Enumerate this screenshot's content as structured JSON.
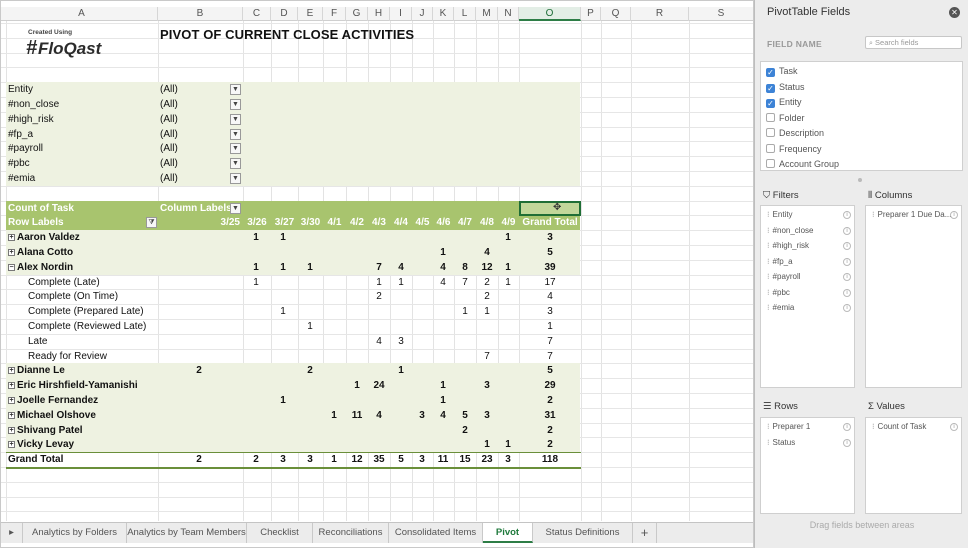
{
  "columns": [
    "A",
    "B",
    "C",
    "D",
    "E",
    "F",
    "G",
    "H",
    "I",
    "J",
    "K",
    "L",
    "M",
    "N",
    "O",
    "P",
    "Q",
    "R",
    "S"
  ],
  "selected_column": "O",
  "logo": {
    "tag": "Created Using",
    "brand": "FloQast"
  },
  "title": "PIVOT OF CURRENT CLOSE ACTIVITIES",
  "filters": [
    {
      "label": "Entity",
      "value": "(All)"
    },
    {
      "label": "#non_close",
      "value": "(All)"
    },
    {
      "label": "#high_risk",
      "value": "(All)"
    },
    {
      "label": "#fp_a",
      "value": "(All)"
    },
    {
      "label": "#payroll",
      "value": "(All)"
    },
    {
      "label": "#pbc",
      "value": "(All)"
    },
    {
      "label": "#emia",
      "value": "(All)"
    }
  ],
  "pivot": {
    "corner": "Count of Task",
    "column_labels": "Column Labels",
    "row_labels": "Row Labels",
    "dates": [
      "3/25",
      "3/26",
      "3/27",
      "3/30",
      "4/1",
      "4/2",
      "4/3",
      "4/4",
      "4/5",
      "4/6",
      "4/7",
      "4/8",
      "4/9"
    ],
    "grand_total_label": "Grand Total",
    "rows": [
      {
        "label": "Aaron Valdez",
        "level": 0,
        "bold": true,
        "toggle": "+",
        "band": "light",
        "values": [
          "",
          "1",
          "1",
          "",
          "",
          "",
          "",
          "",
          "",
          "",
          "",
          "",
          "1"
        ],
        "total": "3"
      },
      {
        "label": "Alana Cotto",
        "level": 0,
        "bold": true,
        "toggle": "+",
        "band": "light",
        "values": [
          "",
          "",
          "",
          "",
          "",
          "",
          "",
          "",
          "",
          "1",
          "",
          "4",
          ""
        ],
        "total": "5"
      },
      {
        "label": "Alex Nordin",
        "level": 0,
        "bold": true,
        "toggle": "−",
        "band": "light",
        "values": [
          "",
          "1",
          "1",
          "1",
          "",
          "",
          "7",
          "4",
          "",
          "4",
          "8",
          "12",
          "1"
        ],
        "total": "39"
      },
      {
        "label": "Complete (Late)",
        "level": 1,
        "bold": false,
        "toggle": "",
        "band": "",
        "values": [
          "",
          "1",
          "",
          "",
          "",
          "",
          "1",
          "1",
          "",
          "4",
          "7",
          "2",
          "1"
        ],
        "total": "17"
      },
      {
        "label": "Complete (On Time)",
        "level": 1,
        "bold": false,
        "toggle": "",
        "band": "",
        "values": [
          "",
          "",
          "",
          "",
          "",
          "",
          "2",
          "",
          "",
          "",
          "",
          "2",
          ""
        ],
        "total": "4"
      },
      {
        "label": "Complete (Prepared Late)",
        "level": 1,
        "bold": false,
        "toggle": "",
        "band": "",
        "values": [
          "",
          "",
          "1",
          "",
          "",
          "",
          "",
          "",
          "",
          "",
          "1",
          "1",
          ""
        ],
        "total": "3"
      },
      {
        "label": "Complete (Reviewed Late)",
        "level": 1,
        "bold": false,
        "toggle": "",
        "band": "",
        "values": [
          "",
          "",
          "",
          "1",
          "",
          "",
          "",
          "",
          "",
          "",
          "",
          "",
          ""
        ],
        "total": "1"
      },
      {
        "label": "Late",
        "level": 1,
        "bold": false,
        "toggle": "",
        "band": "",
        "values": [
          "",
          "",
          "",
          "",
          "",
          "",
          "4",
          "3",
          "",
          "",
          "",
          "",
          ""
        ],
        "total": "7"
      },
      {
        "label": "Ready for Review",
        "level": 1,
        "bold": false,
        "toggle": "",
        "band": "",
        "values": [
          "",
          "",
          "",
          "",
          "",
          "",
          "",
          "",
          "",
          "",
          "",
          "7",
          ""
        ],
        "total": "7"
      },
      {
        "label": "Dianne Le",
        "level": 0,
        "bold": true,
        "toggle": "+",
        "band": "light",
        "values": [
          "2",
          "",
          "",
          "2",
          "",
          "",
          "",
          "1",
          "",
          "",
          "",
          "",
          ""
        ],
        "total": "5"
      },
      {
        "label": "Eric Hirshfield-Yamanishi",
        "level": 0,
        "bold": true,
        "toggle": "+",
        "band": "light",
        "values": [
          "",
          "",
          "",
          "",
          "",
          "1",
          "24",
          "",
          "",
          "1",
          "",
          "3",
          ""
        ],
        "total": "29"
      },
      {
        "label": "Joelle Fernandez",
        "level": 0,
        "bold": true,
        "toggle": "+",
        "band": "light",
        "values": [
          "",
          "",
          "1",
          "",
          "",
          "",
          "",
          "",
          "",
          "1",
          "",
          "",
          ""
        ],
        "total": "2"
      },
      {
        "label": "Michael Olshove",
        "level": 0,
        "bold": true,
        "toggle": "+",
        "band": "light",
        "values": [
          "",
          "",
          "",
          "",
          "1",
          "11",
          "4",
          "",
          "3",
          "4",
          "5",
          "3",
          ""
        ],
        "total": "31"
      },
      {
        "label": "Shivang Patel",
        "level": 0,
        "bold": true,
        "toggle": "+",
        "band": "light",
        "values": [
          "",
          "",
          "",
          "",
          "",
          "",
          "",
          "",
          "",
          "",
          "2",
          "",
          ""
        ],
        "total": "2"
      },
      {
        "label": "Vicky Levay",
        "level": 0,
        "bold": true,
        "toggle": "+",
        "band": "light",
        "values": [
          "",
          "",
          "",
          "",
          "",
          "",
          "",
          "",
          "",
          "",
          "",
          "1",
          "1"
        ],
        "total": "2"
      }
    ],
    "grand_total": {
      "label": "Grand Total",
      "values": [
        "2",
        "2",
        "3",
        "3",
        "1",
        "12",
        "35",
        "5",
        "3",
        "11",
        "15",
        "23",
        "3"
      ],
      "total": "118"
    }
  },
  "tabs": [
    {
      "label": "Analytics by Folders",
      "active": false
    },
    {
      "label": "Analytics by Team Members",
      "active": false
    },
    {
      "label": "Checklist",
      "active": false
    },
    {
      "label": "Reconciliations",
      "active": false
    },
    {
      "label": "Consolidated Items",
      "active": false
    },
    {
      "label": "Pivot",
      "active": true
    },
    {
      "label": "Status Definitions",
      "active": false
    }
  ],
  "add_tab": "+",
  "panel": {
    "title": "PivotTable Fields",
    "field_name_label": "FIELD NAME",
    "search_placeholder": "Search fields",
    "fields": [
      {
        "name": "Task",
        "checked": true
      },
      {
        "name": "Status",
        "checked": true
      },
      {
        "name": "Entity",
        "checked": true
      },
      {
        "name": "Folder",
        "checked": false
      },
      {
        "name": "Description",
        "checked": false
      },
      {
        "name": "Frequency",
        "checked": false
      },
      {
        "name": "Account Group",
        "checked": false
      }
    ],
    "filters_label": "Filters",
    "columns_label": "Columns",
    "rows_label": "Rows",
    "values_label": "Values",
    "filters_items": [
      "Entity",
      "#non_close",
      "#high_risk",
      "#fp_a",
      "#payroll",
      "#pbc",
      "#emia"
    ],
    "columns_items": [
      "Preparer 1 Due Da..."
    ],
    "rows_items": [
      "Preparer 1",
      "Status"
    ],
    "values_items": [
      "Count of Task"
    ],
    "drag_hint": "Drag fields between areas"
  },
  "colors": {
    "accent": "#2d7d46",
    "header_band": "#a8c46e",
    "row_band": "#eef2e1"
  }
}
